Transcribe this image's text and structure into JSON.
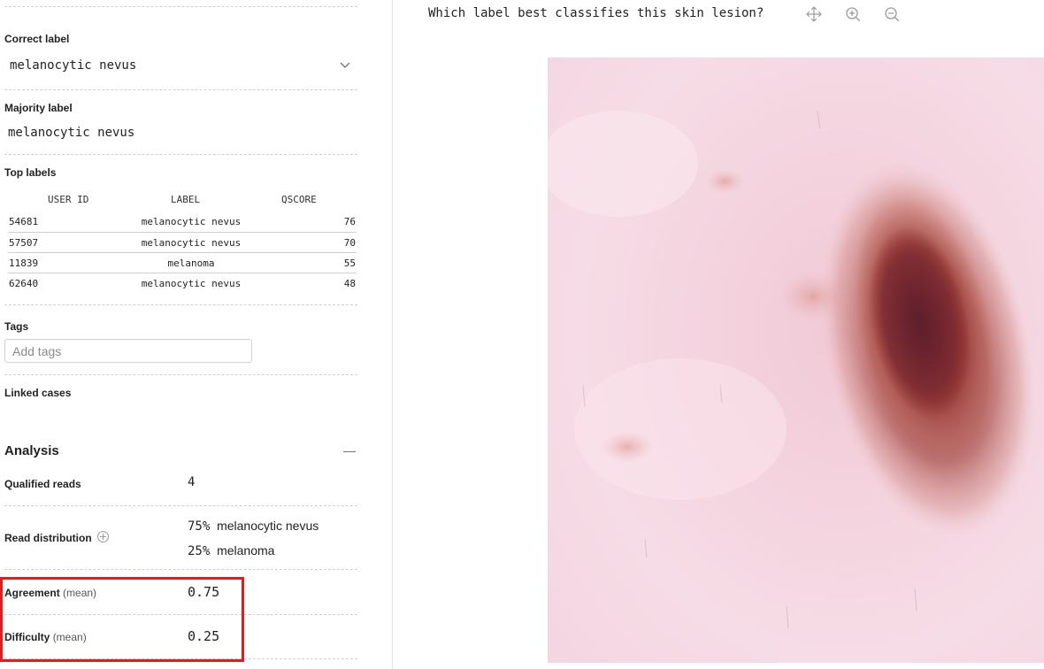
{
  "correct_label": {
    "heading": "Correct label",
    "value": "melanocytic nevus"
  },
  "majority_label": {
    "heading": "Majority label",
    "value": "melanocytic nevus"
  },
  "top_labels": {
    "heading": "Top labels",
    "columns": [
      "USER ID",
      "LABEL",
      "QSCORE"
    ],
    "rows": [
      {
        "user_id": "54681",
        "label": "melanocytic nevus",
        "qscore": "76"
      },
      {
        "user_id": "57507",
        "label": "melanocytic nevus",
        "qscore": "70"
      },
      {
        "user_id": "11839",
        "label": "melanoma",
        "qscore": "55"
      },
      {
        "user_id": "62640",
        "label": "melanocytic nevus",
        "qscore": "48"
      }
    ]
  },
  "tags": {
    "heading": "Tags",
    "placeholder": "Add tags"
  },
  "linked_cases": {
    "heading": "Linked cases"
  },
  "analysis": {
    "title": "Analysis",
    "qualified_reads": {
      "label": "Qualified reads",
      "value": "4"
    },
    "read_distribution": {
      "label": "Read distribution",
      "items": [
        {
          "percent": "75%",
          "label": "melanocytic nevus"
        },
        {
          "percent": "25%",
          "label": "melanoma"
        }
      ]
    },
    "agreement": {
      "label": "Agreement",
      "qualifier": "(mean)",
      "value": "0.75"
    },
    "difficulty": {
      "label": "Difficulty",
      "qualifier": "(mean)",
      "value": "0.25"
    }
  },
  "viewer": {
    "question": "Which label best classifies this skin lesion?",
    "tools": [
      "move-icon",
      "zoom-in-icon",
      "zoom-out-icon"
    ]
  },
  "colors": {
    "highlight": "#e11d1d",
    "skin": "#f4d4e0",
    "lesion": "#6e1c20"
  }
}
